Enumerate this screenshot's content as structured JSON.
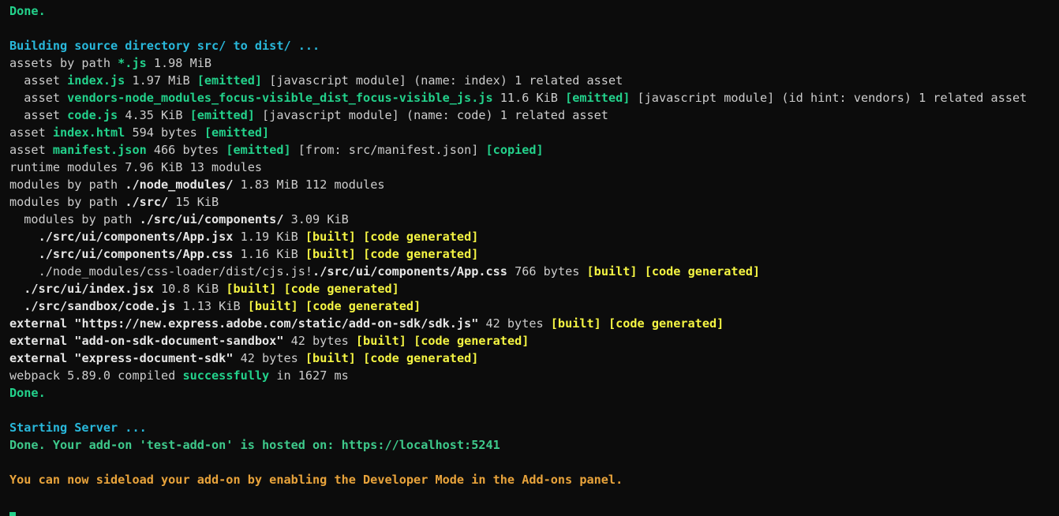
{
  "terminal": {
    "lines": [
      [
        {
          "t": "Done.",
          "c": "green"
        }
      ],
      [],
      [
        {
          "t": "Building source directory src/ to dist/ ...",
          "c": "cyan"
        }
      ],
      [
        {
          "t": "assets by path ",
          "c": "plain"
        },
        {
          "t": "*.js",
          "c": "green"
        },
        {
          "t": " 1.98 MiB",
          "c": "plain"
        }
      ],
      [
        {
          "t": "  asset ",
          "c": "plain"
        },
        {
          "t": "index.js",
          "c": "green"
        },
        {
          "t": " 1.97 MiB ",
          "c": "plain"
        },
        {
          "t": "[emitted]",
          "c": "green"
        },
        {
          "t": " [javascript module] (name: index) 1 related asset",
          "c": "plain"
        }
      ],
      [
        {
          "t": "  asset ",
          "c": "plain"
        },
        {
          "t": "vendors-node_modules_focus-visible_dist_focus-visible_js.js",
          "c": "green"
        },
        {
          "t": " 11.6 KiB ",
          "c": "plain"
        },
        {
          "t": "[emitted]",
          "c": "green"
        },
        {
          "t": " [javascript module] (id hint: vendors) 1 related asset",
          "c": "plain"
        }
      ],
      [
        {
          "t": "  asset ",
          "c": "plain"
        },
        {
          "t": "code.js",
          "c": "green"
        },
        {
          "t": " 4.35 KiB ",
          "c": "plain"
        },
        {
          "t": "[emitted]",
          "c": "green"
        },
        {
          "t": " [javascript module] (name: code) 1 related asset",
          "c": "plain"
        }
      ],
      [
        {
          "t": "asset ",
          "c": "plain"
        },
        {
          "t": "index.html",
          "c": "green"
        },
        {
          "t": " 594 bytes ",
          "c": "plain"
        },
        {
          "t": "[emitted]",
          "c": "green"
        }
      ],
      [
        {
          "t": "asset ",
          "c": "plain"
        },
        {
          "t": "manifest.json",
          "c": "green"
        },
        {
          "t": " 466 bytes ",
          "c": "plain"
        },
        {
          "t": "[emitted]",
          "c": "green"
        },
        {
          "t": " [from: src/manifest.json] ",
          "c": "plain"
        },
        {
          "t": "[copied]",
          "c": "green"
        }
      ],
      [
        {
          "t": "runtime modules 7.96 KiB 13 modules",
          "c": "plain"
        }
      ],
      [
        {
          "t": "modules by path ",
          "c": "plain"
        },
        {
          "t": "./node_modules/",
          "c": "bold"
        },
        {
          "t": " 1.83 MiB 112 modules",
          "c": "plain"
        }
      ],
      [
        {
          "t": "modules by path ",
          "c": "plain"
        },
        {
          "t": "./src/",
          "c": "bold"
        },
        {
          "t": " 15 KiB",
          "c": "plain"
        }
      ],
      [
        {
          "t": "  modules by path ",
          "c": "plain"
        },
        {
          "t": "./src/ui/components/",
          "c": "bold"
        },
        {
          "t": " 3.09 KiB",
          "c": "plain"
        }
      ],
      [
        {
          "t": "    ./src/ui/components/App.jsx",
          "c": "bold"
        },
        {
          "t": " 1.19 KiB ",
          "c": "plain"
        },
        {
          "t": "[built]",
          "c": "yellow"
        },
        {
          "t": " ",
          "c": "plain"
        },
        {
          "t": "[code generated]",
          "c": "yellow"
        }
      ],
      [
        {
          "t": "    ./src/ui/components/App.css",
          "c": "bold"
        },
        {
          "t": " 1.16 KiB ",
          "c": "plain"
        },
        {
          "t": "[built]",
          "c": "yellow"
        },
        {
          "t": " ",
          "c": "plain"
        },
        {
          "t": "[code generated]",
          "c": "yellow"
        }
      ],
      [
        {
          "t": "    ./node_modules/css-loader/dist/cjs.js!",
          "c": "plain"
        },
        {
          "t": "./src/ui/components/App.css",
          "c": "bold"
        },
        {
          "t": " 766 bytes ",
          "c": "plain"
        },
        {
          "t": "[built]",
          "c": "yellow"
        },
        {
          "t": " ",
          "c": "plain"
        },
        {
          "t": "[code generated]",
          "c": "yellow"
        }
      ],
      [
        {
          "t": "  ./src/ui/index.jsx",
          "c": "bold"
        },
        {
          "t": " 10.8 KiB ",
          "c": "plain"
        },
        {
          "t": "[built]",
          "c": "yellow"
        },
        {
          "t": " ",
          "c": "plain"
        },
        {
          "t": "[code generated]",
          "c": "yellow"
        }
      ],
      [
        {
          "t": "  ./src/sandbox/code.js",
          "c": "bold"
        },
        {
          "t": " 1.13 KiB ",
          "c": "plain"
        },
        {
          "t": "[built]",
          "c": "yellow"
        },
        {
          "t": " ",
          "c": "plain"
        },
        {
          "t": "[code generated]",
          "c": "yellow"
        }
      ],
      [
        {
          "t": "external ",
          "c": "bold"
        },
        {
          "t": "\"https://new.express.adobe.com/static/add-on-sdk/sdk.js\"",
          "c": "bold"
        },
        {
          "t": " 42 bytes ",
          "c": "plain"
        },
        {
          "t": "[built]",
          "c": "yellow"
        },
        {
          "t": " ",
          "c": "plain"
        },
        {
          "t": "[code generated]",
          "c": "yellow"
        }
      ],
      [
        {
          "t": "external ",
          "c": "bold"
        },
        {
          "t": "\"add-on-sdk-document-sandbox\"",
          "c": "bold"
        },
        {
          "t": " 42 bytes ",
          "c": "plain"
        },
        {
          "t": "[built]",
          "c": "yellow"
        },
        {
          "t": " ",
          "c": "plain"
        },
        {
          "t": "[code generated]",
          "c": "yellow"
        }
      ],
      [
        {
          "t": "external ",
          "c": "bold"
        },
        {
          "t": "\"express-document-sdk\"",
          "c": "bold"
        },
        {
          "t": " 42 bytes ",
          "c": "plain"
        },
        {
          "t": "[built]",
          "c": "yellow"
        },
        {
          "t": " ",
          "c": "plain"
        },
        {
          "t": "[code generated]",
          "c": "yellow"
        }
      ],
      [
        {
          "t": "webpack 5.89.0 compiled ",
          "c": "plain"
        },
        {
          "t": "successfully",
          "c": "green"
        },
        {
          "t": " in 1627 ms",
          "c": "plain"
        }
      ],
      [
        {
          "t": "Done.",
          "c": "green"
        }
      ],
      [],
      [
        {
          "t": "Starting Server ...",
          "c": "cyan"
        }
      ],
      [
        {
          "t": "Done. Your add-on 'test-add-on' is hosted on: https://localhost:5241",
          "c": "green-plain"
        }
      ],
      [],
      [
        {
          "t": "You can now sideload your add-on by enabling the Developer Mode in the Add-ons panel.",
          "c": "orange"
        }
      ]
    ]
  },
  "colors": {
    "background": "#0c0c0c",
    "text": "#cccccc",
    "green": "#23d18b",
    "yellow": "#f5f543",
    "cyan": "#29b8db",
    "orange": "#e8a33b"
  }
}
